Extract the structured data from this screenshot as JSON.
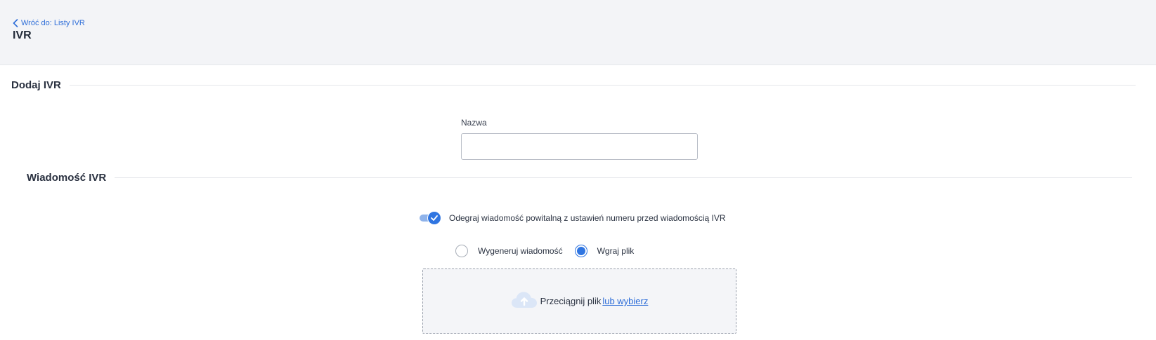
{
  "header": {
    "back_label": "Wróć do: Listy IVR",
    "title": "IVR"
  },
  "form": {
    "section_title": "Dodaj IVR",
    "name_label": "Nazwa",
    "name_value": ""
  },
  "message": {
    "section_title": "Wiadomość IVR",
    "toggle_label": "Odegraj wiadomość powitalną z ustawień numeru przed wiadomością IVR",
    "toggle_on": true,
    "options": [
      {
        "label": "Wygeneruj wiadomość",
        "selected": false
      },
      {
        "label": "Wgraj plik",
        "selected": true
      }
    ],
    "dropzone_text": "Przeciągnij plik",
    "dropzone_link": "lub wybierz"
  },
  "colors": {
    "accent": "#2f75e1",
    "link": "#2d6dd8",
    "header_bg": "#f3f4f7"
  },
  "icons": {
    "back": "chevron-left-icon",
    "toggle": "check-icon",
    "upload": "cloud-upload-icon"
  }
}
